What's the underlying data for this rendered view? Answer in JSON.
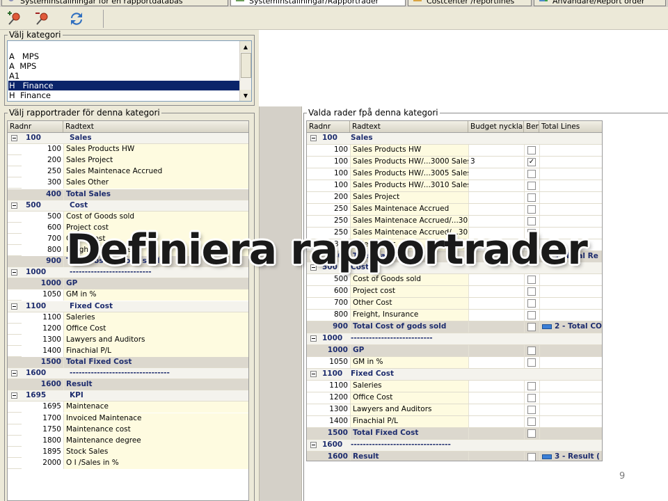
{
  "tabs": [
    {
      "label": "Systeminställningar för en rapportdatabas"
    },
    {
      "label": "Systeminställningar/Rapportrader"
    },
    {
      "label": "Costcenter /reportlines"
    },
    {
      "label": "Användare/Report order"
    }
  ],
  "toolbar": {
    "icons": [
      "pin-add-icon",
      "pin-remove-icon",
      "refresh-icon"
    ]
  },
  "category": {
    "legend": "Välj kategori",
    "items": [
      {
        "code": "A",
        "name": "MPS"
      },
      {
        "code": "A",
        "name": "MPS"
      },
      {
        "code": "A1",
        "name": ""
      },
      {
        "code": "H",
        "name": "Finance",
        "selected": true
      },
      {
        "code": "H",
        "name": "Finance"
      }
    ]
  },
  "left": {
    "legend": "Välj rapportrader för denna kategori",
    "columns": [
      "Radnr",
      "Radtext"
    ],
    "groups": [
      {
        "nr": "100",
        "text": "Sales",
        "rows": [
          {
            "nr": "100",
            "text": "Sales Products HW"
          },
          {
            "nr": "200",
            "text": "Sales Project"
          },
          {
            "nr": "250",
            "text": "Sales Maintenace Accrued"
          },
          {
            "nr": "300",
            "text": "Sales Other"
          },
          {
            "nr": "400",
            "text": "Total Sales",
            "total": true
          }
        ]
      },
      {
        "nr": "500",
        "text": "Cost",
        "rows": [
          {
            "nr": "500",
            "text": "Cost of Goods sold"
          },
          {
            "nr": "600",
            "text": "Project cost"
          },
          {
            "nr": "700",
            "text": "Other Cost"
          },
          {
            "nr": "800",
            "text": "Freight, Insurance"
          },
          {
            "nr": "900",
            "text": "Total Cost of gods sold",
            "total": true
          }
        ]
      },
      {
        "nr": "1000",
        "text": "---------------------------",
        "rows": [
          {
            "nr": "1000",
            "text": "GP",
            "total": true
          },
          {
            "nr": "1050",
            "text": "GM in %"
          }
        ]
      },
      {
        "nr": "1100",
        "text": "Fixed Cost",
        "rows": [
          {
            "nr": "1100",
            "text": "Saleries"
          },
          {
            "nr": "1200",
            "text": "Office Cost"
          },
          {
            "nr": "1300",
            "text": "Lawyers and Auditors"
          },
          {
            "nr": "1400",
            "text": "Finachial P/L"
          },
          {
            "nr": "1500",
            "text": "Total Fixed Cost",
            "total": true
          }
        ]
      },
      {
        "nr": "1600",
        "text": "---------------------------------",
        "rows": [
          {
            "nr": "1600",
            "text": "Result",
            "total": true
          }
        ]
      },
      {
        "nr": "1695",
        "text": "KPI",
        "rows": [
          {
            "nr": "1695",
            "text": "Maintenace"
          },
          {
            "nr": "1700",
            "text": "Invoiced Maintenace"
          },
          {
            "nr": "1750",
            "text": "Maintenance cost"
          },
          {
            "nr": "1800",
            "text": "Maintenance degree"
          },
          {
            "nr": "1895",
            "text": "Stock Sales"
          },
          {
            "nr": "2000",
            "text": "O I /Sales in %"
          }
        ]
      }
    ]
  },
  "right": {
    "legend": "Valda rader fpå denna kategori",
    "columns": [
      "Radnr",
      "Radtext",
      "Budget nycklar",
      "Ber",
      "Total Lines"
    ],
    "groups": [
      {
        "nr": "100",
        "text": "Sales",
        "rows": [
          {
            "nr": "100",
            "text": "Sales Products HW",
            "budget": "",
            "ber": false,
            "tl": ""
          },
          {
            "nr": "100",
            "text": "Sales Products HW/...3000 Sales",
            "budget": "3",
            "ber": true,
            "tl": ""
          },
          {
            "nr": "100",
            "text": "Sales Products HW/...3005 Sales",
            "budget": "",
            "ber": false,
            "tl": ""
          },
          {
            "nr": "100",
            "text": "Sales Products HW/...3010 Sales",
            "budget": "",
            "ber": false,
            "tl": ""
          },
          {
            "nr": "200",
            "text": "Sales Project",
            "budget": "",
            "ber": false,
            "tl": ""
          },
          {
            "nr": "250",
            "text": "Sales Maintenace Accrued",
            "budget": "",
            "ber": false,
            "tl": ""
          },
          {
            "nr": "250",
            "text": "Sales Maintenace Accrued/...301",
            "budget": "",
            "ber": false,
            "tl": ""
          },
          {
            "nr": "250",
            "text": "Sales Maintenace Accrued/...301",
            "budget": "",
            "ber": false,
            "tl": ""
          },
          {
            "nr": "300",
            "text": "Sales Other",
            "budget": "",
            "ber": false,
            "tl": ""
          },
          {
            "nr": "400",
            "text": "Total Sales",
            "budget": "",
            "ber": false,
            "tl": "1- Total Re",
            "total": true
          }
        ]
      },
      {
        "nr": "500",
        "text": "Cost",
        "rows": [
          {
            "nr": "500",
            "text": "Cost of Goods sold",
            "budget": "",
            "ber": false,
            "tl": ""
          },
          {
            "nr": "600",
            "text": "Project cost",
            "budget": "",
            "ber": false,
            "tl": ""
          },
          {
            "nr": "700",
            "text": "Other Cost",
            "budget": "",
            "ber": false,
            "tl": ""
          },
          {
            "nr": "800",
            "text": "Freight, Insurance",
            "budget": "",
            "ber": false,
            "tl": ""
          },
          {
            "nr": "900",
            "text": "Total Cost of gods sold",
            "budget": "",
            "ber": false,
            "tl": "2 - Total CO",
            "total": true
          }
        ]
      },
      {
        "nr": "1000",
        "text": "---------------------------",
        "rows": [
          {
            "nr": "1000",
            "text": "GP",
            "budget": "",
            "ber": false,
            "tl": "",
            "total": true
          },
          {
            "nr": "1050",
            "text": "GM in %",
            "budget": "",
            "ber": false,
            "tl": ""
          }
        ]
      },
      {
        "nr": "1100",
        "text": "Fixed Cost",
        "rows": [
          {
            "nr": "1100",
            "text": "Saleries",
            "budget": "",
            "ber": false,
            "tl": ""
          },
          {
            "nr": "1200",
            "text": "Office Cost",
            "budget": "",
            "ber": false,
            "tl": ""
          },
          {
            "nr": "1300",
            "text": "Lawyers and Auditors",
            "budget": "",
            "ber": false,
            "tl": ""
          },
          {
            "nr": "1400",
            "text": "Finachial P/L",
            "budget": "",
            "ber": false,
            "tl": ""
          },
          {
            "nr": "1500",
            "text": "Total Fixed Cost",
            "budget": "",
            "ber": false,
            "tl": "",
            "total": true
          }
        ]
      },
      {
        "nr": "1600",
        "text": "---------------------------------",
        "rows": [
          {
            "nr": "1600",
            "text": "Result",
            "budget": "",
            "ber": false,
            "tl": "3 - Result (",
            "total": true
          }
        ]
      }
    ]
  },
  "overlay_title": "Definiera rapportrader",
  "page_number": "9"
}
